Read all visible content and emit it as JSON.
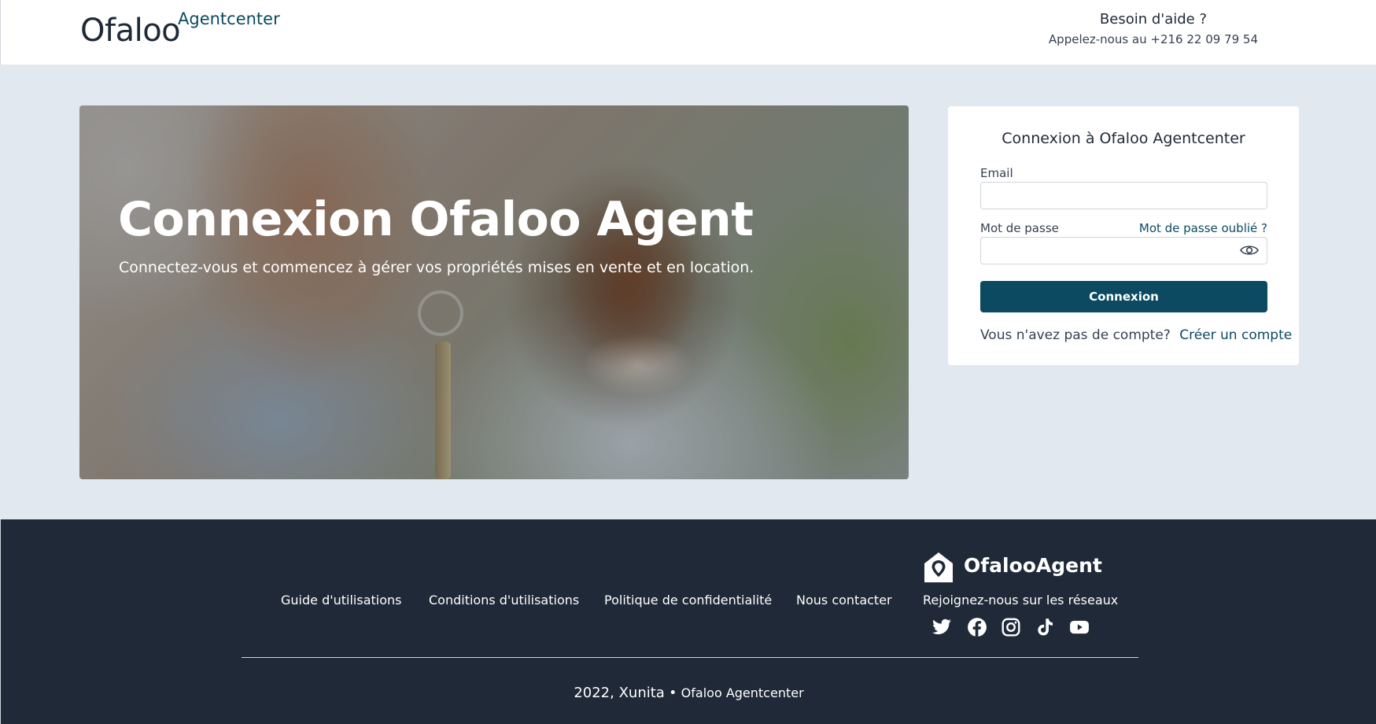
{
  "header": {
    "logo_main": "Ofaloo",
    "logo_sup": "Agentcenter",
    "help_title": "Besoin d'aide ?",
    "help_phone": "Appelez-nous au +216 22 09 79 54"
  },
  "hero": {
    "title": "Connexion Ofaloo Agent",
    "subtitle": "Connectez-vous et commencez à gérer vos propriétés mises en vente et en location."
  },
  "login": {
    "title": "Connexion à Ofaloo Agentcenter",
    "email_label": "Email",
    "email_value": "",
    "password_label": "Mot de passe",
    "password_value": "",
    "forgot_link": "Mot de passe oublié ?",
    "submit_label": "Connexion",
    "no_account_text": "Vous n'avez pas de compte?",
    "signup_link": "Créer un compte"
  },
  "footer": {
    "nav": [
      "Guide d'utilisations",
      "Conditions d'utilisations",
      "Politique de confidentialité",
      "Nous contacter"
    ],
    "brand_name": "OfalooAgent",
    "join_text": "Rejoignez-nous sur les réseaux",
    "social_icons": [
      "twitter-icon",
      "facebook-icon",
      "instagram-icon",
      "tiktok-icon",
      "youtube-icon"
    ],
    "copyright_year": "2022, Xunita",
    "copyright_sep": " • ",
    "copyright_name": "Ofaloo Agentcenter"
  },
  "colors": {
    "primary": "#0b4a60",
    "footer_bg": "#1f2937",
    "page_bg": "#e2e8f0"
  }
}
